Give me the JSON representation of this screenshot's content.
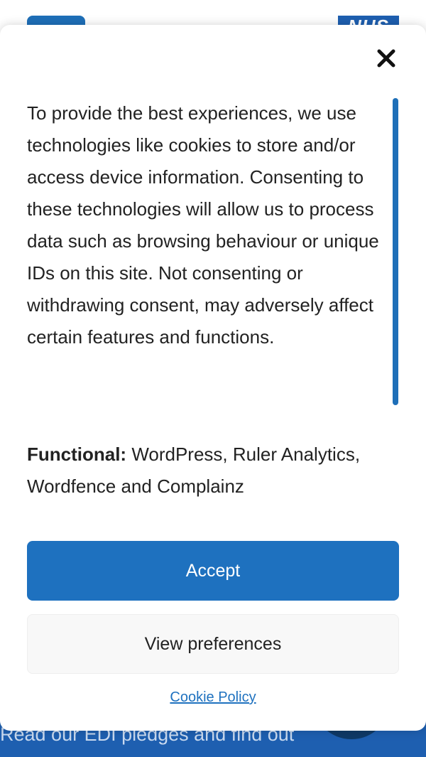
{
  "background": {
    "logo_text": "NHS",
    "band_text": "Read our EDI pledges and find out"
  },
  "cookie_banner": {
    "close_icon": "close-icon",
    "message": "To provide the best experiences, we use technologies like cookies to store and/or access device information. Consenting to these technologies will allow us to process data such as browsing behaviour or unique IDs on this site. Not consenting or withdrawing consent, may adversely affect certain features and functions.",
    "functional_label": "Functional:",
    "functional_text": " WordPress, Ruler Analytics, Wordfence and Complainz",
    "accept_label": "Accept",
    "preferences_label": "View preferences",
    "policy_link": "Cookie Policy"
  },
  "colors": {
    "accent": "#1e71bf",
    "band": "#1e5fb0"
  }
}
